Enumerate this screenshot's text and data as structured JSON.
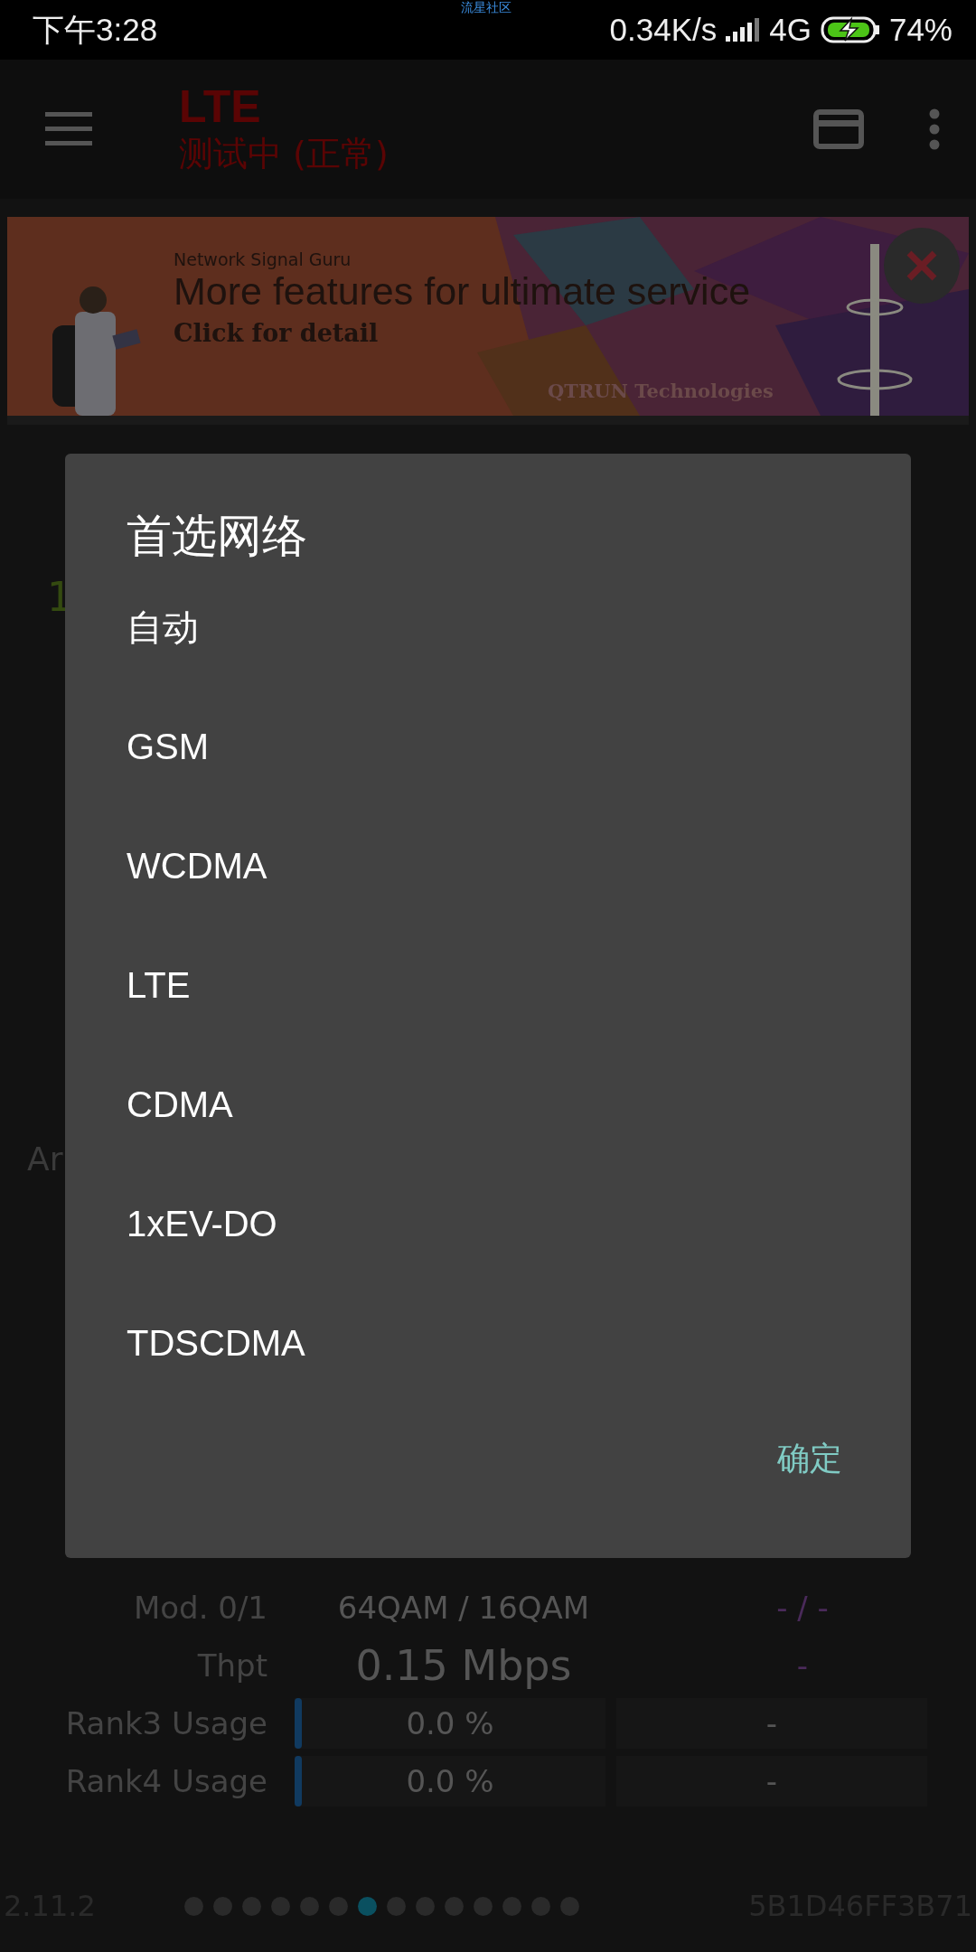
{
  "status_bar": {
    "time": "下午3:28",
    "carrier_note": "流星社区",
    "speed": "0.34K/s",
    "network": "4G",
    "battery": "74%"
  },
  "app_bar": {
    "title": "LTE",
    "subtitle": "测试中 (正常)"
  },
  "banner": {
    "brand": "Network Signal Guru",
    "headline": "More features for ultimate service",
    "cta": "Click for detail",
    "company": "QTRUN Technologies"
  },
  "background_fragments": [
    "1",
    "Ar"
  ],
  "rows": [
    {
      "kind": "text",
      "label": "Mod. 0/1",
      "value": "64QAM / 16QAM",
      "other": "- / -"
    },
    {
      "kind": "big",
      "label": "Thpt",
      "value": "0.15 Mbps",
      "other": "-"
    },
    {
      "kind": "bar",
      "label": "Rank3 Usage",
      "value": "0.0 %",
      "other": "-",
      "level": 0
    },
    {
      "kind": "bar",
      "label": "Rank4 Usage",
      "value": "0.0 %",
      "other": "-",
      "level": 0
    }
  ],
  "footer": {
    "version": "2.11.2",
    "device_id": "5B1D46FF3B71",
    "pages": [
      {
        "selected": false
      },
      {
        "selected": false
      },
      {
        "selected": false
      },
      {
        "selected": false
      },
      {
        "selected": false
      },
      {
        "selected": false
      },
      {
        "selected": true
      },
      {
        "selected": false
      },
      {
        "selected": false
      },
      {
        "selected": false
      },
      {
        "selected": false
      },
      {
        "selected": false
      },
      {
        "selected": false
      },
      {
        "selected": false
      }
    ]
  },
  "dialog": {
    "title": "首选网络",
    "options": [
      "自动",
      "GSM",
      "WCDMA",
      "LTE",
      "CDMA",
      "1xEV-DO",
      "TDSCDMA"
    ],
    "confirm": "确定"
  }
}
